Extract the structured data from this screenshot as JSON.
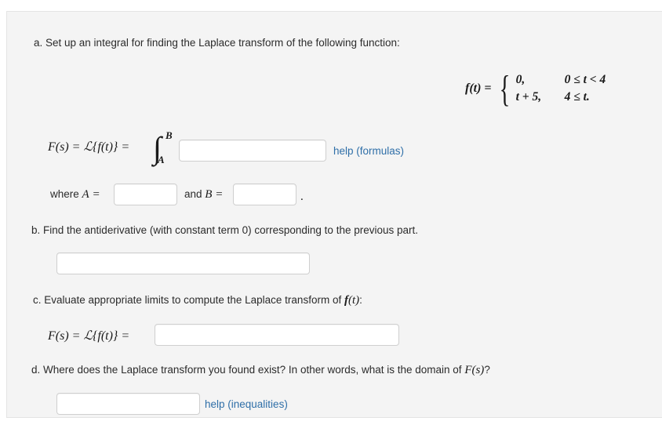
{
  "panel": {
    "background_color": "#f4f4f4",
    "border_color": "#e4e4e4"
  },
  "colors": {
    "link": "#2f6fa8",
    "text": "#2b2b2b",
    "math": "#1a1a1a",
    "input_border": "#cfcfcf",
    "input_background": "#ffffff"
  },
  "parts": {
    "a": {
      "prompt": "a. Set up an integral for finding the Laplace transform of the following function:",
      "piecewise": {
        "lhs": "f(t) =",
        "rows": [
          {
            "value": "0,",
            "condition": "0 ≤ t < 4"
          },
          {
            "value": "t + 5,",
            "condition": "4 ≤ t."
          }
        ]
      },
      "integral_lhs": "F(s) = ℒ{f(t)} =",
      "integral_upper_limit": "B",
      "integral_lower_limit": "A",
      "integrand_value": "",
      "integrand_placeholder": "",
      "help_label": "help (formulas)",
      "where_label": "where A =",
      "a_value": "",
      "and_label": "and B =",
      "b_value": "",
      "trailing_period": "."
    },
    "b": {
      "prompt": "b. Find the antiderivative (with constant term 0) corresponding to the previous part.",
      "answer_value": "",
      "answer_placeholder": ""
    },
    "c": {
      "prompt": "c. Evaluate appropriate limits to compute the Laplace transform of f(t):",
      "formula_lhs": "F(s) = ℒ{f(t)} =",
      "answer_value": "",
      "answer_placeholder": ""
    },
    "d": {
      "prompt": "d. Where does the Laplace transform you found exist? In other words, what is the domain of F(s)?",
      "answer_value": "",
      "answer_placeholder": "",
      "help_label": "help (inequalities)"
    }
  }
}
